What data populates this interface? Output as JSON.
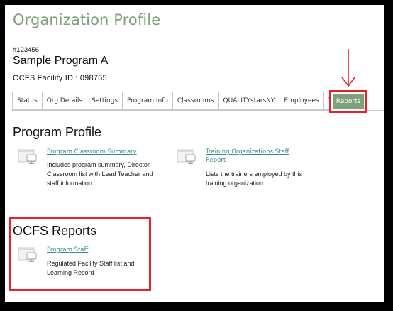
{
  "page": {
    "title": "Organization Profile"
  },
  "org": {
    "id": "#123456",
    "name": "Sample Program A",
    "facility_id": "OCFS Facility ID : 098765"
  },
  "tabs": [
    {
      "label": "Status"
    },
    {
      "label": "Org Details"
    },
    {
      "label": "Settings"
    },
    {
      "label": "Program Info"
    },
    {
      "label": "Classrooms"
    },
    {
      "label": "QUALITYstarsNY"
    },
    {
      "label": "Employees"
    },
    {
      "label": "TA"
    }
  ],
  "active_tab": {
    "label": "Reports"
  },
  "program_profile": {
    "title": "Program Profile",
    "cards": [
      {
        "link": "Program Classroom Summary",
        "desc_lines": [
          "Includes program summary, Director,",
          "Classroom list with Lead Teacher and",
          "staff information"
        ]
      },
      {
        "link_lines": [
          "Training Organizations Staff",
          "Report"
        ],
        "desc_lines": [
          "Lists the trainers employed by this",
          "training organization"
        ]
      }
    ]
  },
  "ocfs_reports": {
    "title": "OCFS Reports",
    "cards": [
      {
        "link": "Program Staff",
        "desc_lines": [
          "Regulated Facility Staff list and",
          "Learning Record"
        ]
      }
    ]
  },
  "colors": {
    "brand_green": "#7ea07a",
    "link_teal": "#3c8a8a",
    "highlight_red": "#e8202a"
  }
}
